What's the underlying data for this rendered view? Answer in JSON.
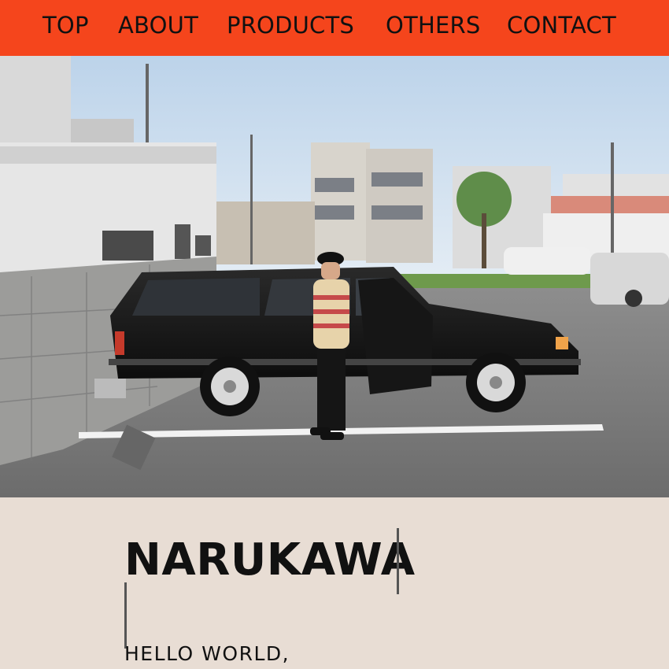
{
  "nav": {
    "items": [
      "TOP",
      "ABOUT",
      "PRODUCTS",
      "OTHERS",
      "CONTACT"
    ],
    "background_color": "#f5451c"
  },
  "hero": {
    "image_description": "photo-of-person-beside-black-station-wagon-in-parking-lot"
  },
  "main": {
    "title": "NARUKAWA",
    "subtitle": "HELLO WORLD,",
    "background_color": "#e8ddd4"
  }
}
